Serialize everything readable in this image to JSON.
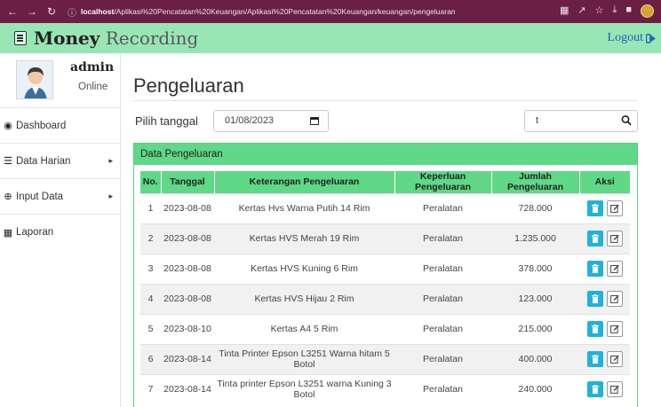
{
  "browser": {
    "url_prefix": "localhost",
    "url_rest": "/Aplikasi%20Pencatatan%20Keuangan/Aplikasi%20Pencatatan%20Keuangan/keuangan/pengeluaran",
    "bar_color": "#6b1f45"
  },
  "app": {
    "brand_bold": "Money",
    "brand_rest": " Recording",
    "logout_label": "Logout",
    "header_color": "#98e6b4"
  },
  "sidebar": {
    "user_name": "admin",
    "user_status": "Online",
    "items": [
      {
        "label": "Dashboard",
        "icon": "dashboard-icon"
      },
      {
        "label": "Data Harian",
        "icon": "database-icon"
      },
      {
        "label": "Input Data",
        "icon": "plus-circle-icon"
      },
      {
        "label": "Laporan",
        "icon": "file-icon"
      }
    ]
  },
  "main": {
    "page_title": "Pengeluaran",
    "date_label": "Pilih tanggal",
    "date_value": "01/08/2023",
    "search_value": "t",
    "panel_title": "Data Pengeluaran",
    "accent_color": "#5fd887",
    "delete_color": "#1fb2dd",
    "table_headers": [
      "No.",
      "Tanggal",
      "Keterangan Pengeluaran",
      "Keperluan Pengeluaran",
      "Jumlah Pengeluaran",
      "Aksi"
    ],
    "rows": [
      {
        "no": "1",
        "tanggal": "2023-08-08",
        "keterangan": "Kertas Hvs Warna Putih 14 Rim",
        "keperluan": "Peralatan",
        "jumlah": "728.000"
      },
      {
        "no": "2",
        "tanggal": "2023-08-08",
        "keterangan": "Kertas HVS Merah 19 Rim",
        "keperluan": "Peralatan",
        "jumlah": "1.235.000"
      },
      {
        "no": "3",
        "tanggal": "2023-08-08",
        "keterangan": "Kertas HVS Kuning 6 Rim",
        "keperluan": "Peralatan",
        "jumlah": "378.000"
      },
      {
        "no": "4",
        "tanggal": "2023-08-08",
        "keterangan": "Kertas HVS Hijau 2 Rim",
        "keperluan": "Peralatan",
        "jumlah": "123.000"
      },
      {
        "no": "5",
        "tanggal": "2023-08-10",
        "keterangan": "Kertas A4 5 Rim",
        "keperluan": "Peralatan",
        "jumlah": "215.000"
      },
      {
        "no": "6",
        "tanggal": "2023-08-14",
        "keterangan": "Tinta Printer Epson L3251 Warna hitam 5 Botol",
        "keperluan": "Peralatan",
        "jumlah": "400.000"
      },
      {
        "no": "7",
        "tanggal": "2023-08-14",
        "keterangan": "Tinta printer Epson L3251 warna Kuning 3 Botol",
        "keperluan": "Peralatan",
        "jumlah": "240.000"
      }
    ]
  }
}
